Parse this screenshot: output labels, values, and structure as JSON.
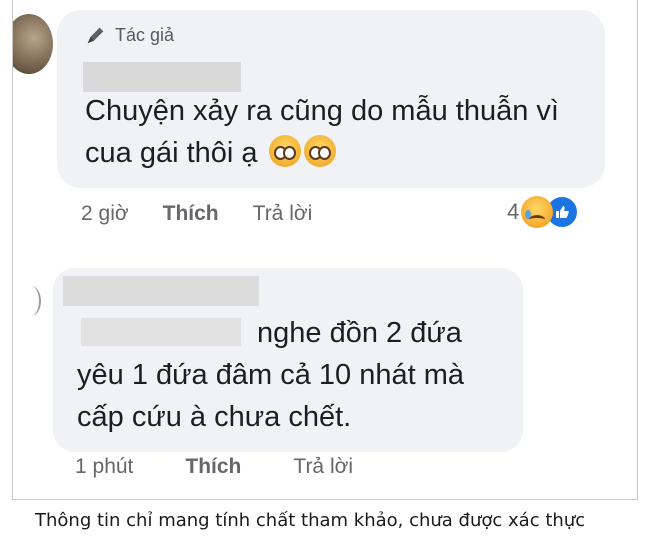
{
  "comment1": {
    "author_badge": "Tác giả",
    "text": "Chuyện xảy ra cũng do mẫu thuẫn vì cua gái thôi ạ",
    "emojis": [
      "pleading-face-icon",
      "pleading-face-icon"
    ],
    "time": "2 giờ",
    "like_label": "Thích",
    "reply_label": "Trả lời",
    "reaction_count": "4",
    "reaction_icons": [
      "sad-face-icon",
      "like-icon"
    ]
  },
  "comment2": {
    "text_line1": "nghe đồn 2 đứa",
    "text_line2": "yêu 1 đứa đâm cả 10 nhát mà",
    "text_line3": "cấp cứu à chưa chết.",
    "time": "1 phút",
    "like_label": "Thích",
    "reply_label": "Trả lời"
  },
  "caption": "Thông tin chỉ mang tính chất tham khảo, chưa được xác thực",
  "colors": {
    "bubble_bg": "#f0f2f5",
    "meta_text": "#65676b",
    "like_blue": "#1b74e4"
  }
}
